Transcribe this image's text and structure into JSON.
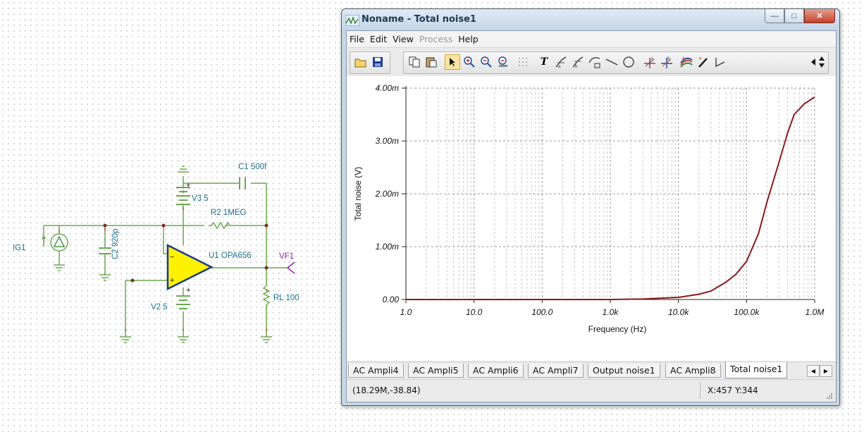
{
  "schematic": {
    "labels": {
      "source": "IG1",
      "cap_c2": "C2 920p",
      "v3": "V3 5",
      "c1": "C1 500f",
      "r2": "R2 1MEG",
      "opamp": "U1 OPA656",
      "vf1": "VF1",
      "v2": "V2 5",
      "rl": "RL 100",
      "plus_v3": "+",
      "plus_v2": "+",
      "minus_in": "−",
      "plus_in": "+"
    }
  },
  "window": {
    "title": "Noname - Total noise1",
    "menu": [
      "File",
      "Edit",
      "View",
      "Process",
      "Help"
    ],
    "menu_disabled": [
      "Process"
    ],
    "toolbar_icons": [
      "open-icon",
      "save-icon",
      "copy-icon",
      "paste-icon",
      "pointer-icon",
      "zoom-in-icon",
      "zoom-out-icon",
      "zoom-100-icon",
      "grid-icon",
      "text-icon",
      "cursor-a-icon",
      "cursor-b-icon",
      "curve-icon",
      "line-icon",
      "circle-icon",
      "marker-a-icon",
      "marker-b-icon",
      "color-icon",
      "pen-icon",
      "angle-icon",
      "scroll-left-icon",
      "scroll-updown-icon"
    ],
    "tabs": [
      "AC Ampli4",
      "AC Ampli5",
      "AC Ampli6",
      "AC Ampli7",
      "Output noise1",
      "AC Ampli8",
      "Total noise1"
    ],
    "active_tab": "Total noise1",
    "status_left": "(18.29M,-38.84)",
    "status_right": "X:457  Y:344"
  },
  "chart_data": {
    "type": "line",
    "ylabel": "Total noise (V)",
    "xlabel": "Frequency (Hz)",
    "x_scale": "log",
    "xlim": [
      1,
      1000000
    ],
    "ylim": [
      0,
      0.004
    ],
    "x_tick_labels": [
      "1.0",
      "10.0",
      "100.0",
      "1.0k",
      "10.0k",
      "100.0k",
      "1.0M"
    ],
    "y_tick_labels": [
      "0.00",
      "1.00m",
      "2.00m",
      "3.00m",
      "4.00m"
    ],
    "y_tick_values": [
      0,
      0.001,
      0.002,
      0.003,
      0.004
    ],
    "grid": true,
    "line_color": "#8b1a1a",
    "series": [
      {
        "x": [
          1,
          10,
          100,
          1000,
          3000,
          10000,
          20000,
          30000,
          50000,
          70000,
          100000,
          150000,
          200000,
          300000,
          400000,
          500000,
          700000,
          1000000
        ],
        "values": [
          0.0,
          0.0,
          0.0,
          0.0,
          1e-05,
          4e-05,
          0.0001,
          0.00016,
          0.00033,
          0.00048,
          0.00072,
          0.00125,
          0.00185,
          0.0026,
          0.00315,
          0.0035,
          0.0037,
          0.00383
        ]
      }
    ]
  }
}
